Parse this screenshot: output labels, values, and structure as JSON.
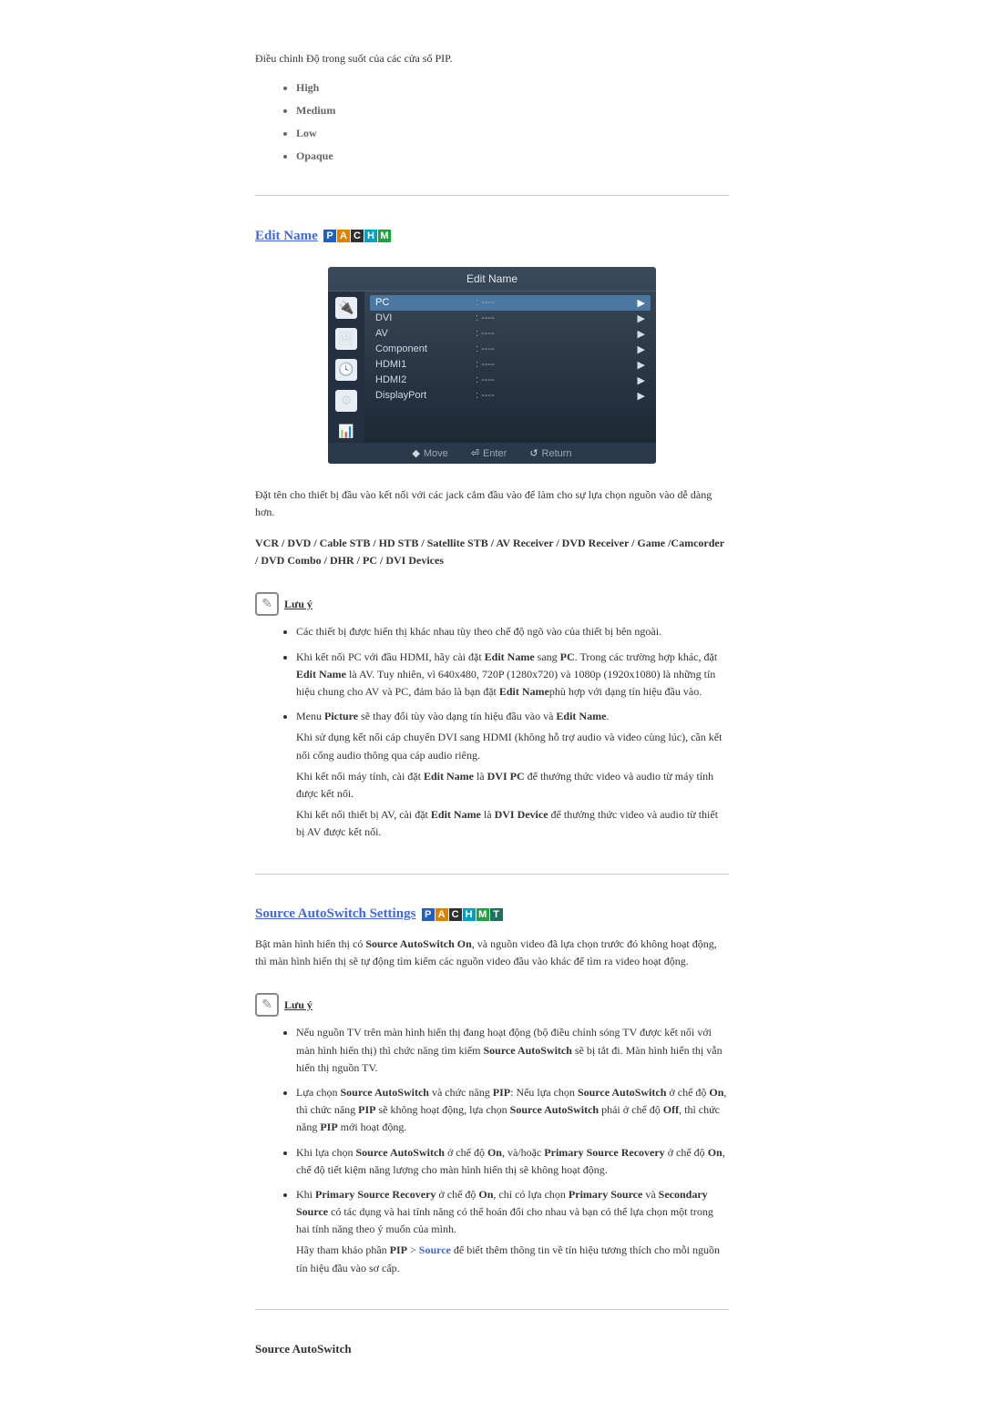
{
  "transparency": {
    "intro": "Điều chỉnh Độ trong suốt của các cửa sổ PIP.",
    "items": [
      "High",
      "Medium",
      "Low",
      "Opaque"
    ]
  },
  "edit_name": {
    "heading": "Edit Name",
    "badges": [
      "P",
      "A",
      "C",
      "H",
      "M"
    ],
    "panel": {
      "title": "Edit Name",
      "rows": [
        {
          "lbl": "PC",
          "mid": ": ----",
          "sel": true
        },
        {
          "lbl": "DVI",
          "mid": ": ----"
        },
        {
          "lbl": "AV",
          "mid": ": ----"
        },
        {
          "lbl": "Component",
          "mid": ": ----"
        },
        {
          "lbl": "HDMI1",
          "mid": ": ----"
        },
        {
          "lbl": "HDMI2",
          "mid": ": ----"
        },
        {
          "lbl": "DisplayPort",
          "mid": ": ----"
        }
      ],
      "footer": {
        "move": "Move",
        "enter": "Enter",
        "return": "Return"
      }
    },
    "desc": "Đặt tên cho thiết bị đầu vào kết nối với các jack cắm đầu vào để làm cho sự lựa chọn nguồn vào dễ dàng hơn.",
    "options": "VCR / DVD / Cable STB / HD STB / Satellite STB / AV Receiver / DVD Receiver / Game /Camcorder / DVD Combo / DHR / PC / DVI Devices",
    "note_label": "Lưu ý",
    "notes": {
      "n1": "Các thiết bị được hiển thị khác nhau tùy theo chế độ ngõ vào của thiết bị bên ngoài.",
      "n2": {
        "pre": "Khi kết nối PC với đầu HDMI, hãy cài đặt ",
        "b1": "Edit Name",
        "mid1": " sang ",
        "b2": "PC",
        "mid2": ". Trong các trường hợp khác, đặt ",
        "b3": "Edit Name",
        "mid3": " là AV. Tuy nhiên, vì 640x480, 720P (1280x720) và 1080p (1920x1080) là những tín hiệu chung cho AV và PC, đảm bảo là bạn đặt ",
        "b4": "Edit Name",
        "post": "phù hợp với dạng tín hiệu đầu vào."
      },
      "n3": {
        "pre": "Menu ",
        "b1": "Picture",
        "mid": " sẽ thay đổi tùy vào dạng tín hiệu đầu vào và ",
        "b2": "Edit Name",
        "post": "."
      },
      "n3_sub1": "Khi sử dụng kết nối cáp chuyển DVI sang HDMI (không hỗ trợ audio và video cùng lúc), cần kết nối cổng audio thông qua cáp audio riêng.",
      "n3_sub2_pre": "Khi kết nối máy tính, cài đặt ",
      "n3_sub2_b1": "Edit Name",
      "n3_sub2_mid": " là ",
      "n3_sub2_b2": "DVI PC",
      "n3_sub2_post": " để thưởng thức video và audio từ máy tính được kết nối.",
      "n3_sub3_pre": "Khi kết nối thiết bị AV, cài đặt ",
      "n3_sub3_b1": "Edit Name",
      "n3_sub3_mid": " là ",
      "n3_sub3_b2": "DVI Device",
      "n3_sub3_post": " để thưởng thức video và audio từ thiết bị AV được kết nối."
    }
  },
  "autoswitch": {
    "heading": "Source AutoSwitch Settings",
    "badges": [
      "P",
      "A",
      "C",
      "H",
      "M",
      "T"
    ],
    "desc": {
      "pre": "Bật màn hình hiển thị có ",
      "b1": "Source AutoSwitch On",
      "post": ", và nguồn video đã lựa chọn trước đó không hoạt động, thì màn hình hiển thị sẽ tự động tìm kiếm các nguồn video đầu vào khác để tìm ra video hoạt động."
    },
    "note_label": "Lưu ý",
    "notes": {
      "n1": {
        "pre": "Nếu nguồn TV trên màn hình hiển thị đang hoạt động (bộ điều chỉnh sóng TV được kết nối với màn hình hiển thị) thì chức năng tìm kiếm ",
        "b1": "Source AutoSwitch",
        "post": " sẽ bị tắt đi. Màn hình hiển thị vẫn hiển thị nguồn TV."
      },
      "n2": {
        "pre": "Lựa chọn ",
        "b1": "Source AutoSwitch",
        "mid1": " và chức năng ",
        "b2": "PIP",
        "mid2": ": Nếu lựa chọn ",
        "b3": "Source AutoSwitch",
        "mid3": " ở chế độ ",
        "b4": "On",
        "mid4": ", thì chức năng ",
        "b5": "PIP",
        "mid5": " sẽ không hoạt động, lựa chọn ",
        "b6": "Source AutoSwitch",
        "mid6": " phải ở chế độ ",
        "b7": "Off",
        "mid7": ", thì chức năng ",
        "b8": "PIP",
        "post": " mới hoạt động."
      },
      "n3": {
        "pre": "Khi lựa chọn ",
        "b1": "Source AutoSwitch",
        "mid1": " ở chế độ ",
        "b2": "On",
        "mid2": ", và/hoặc ",
        "b3": "Primary Source Recovery",
        "mid3": " ở chế độ ",
        "b4": "On",
        "post": ", chế độ tiết kiệm năng lượng cho màn hình hiển thị sẽ không hoạt động."
      },
      "n4": {
        "pre": "Khi ",
        "b1": "Primary Source Recovery",
        "mid1": " ở chế độ ",
        "b2": "On",
        "mid2": ", chỉ có lựa chọn ",
        "b3": "Primary Source",
        "mid3": " và ",
        "b4": "Secondary Source",
        "post": " có tác dụng và hai tính năng có thể hoán đổi cho nhau và bạn có thể lựa chọn một trong hai tính năng theo ý muốn của mình."
      },
      "n4_sub": {
        "pre": "Hãy tham khảo phần ",
        "b1": "PIP",
        "mid": " > ",
        "link": "Source",
        "post": " để biết thêm thông tin về tín hiệu tương thích cho mỗi nguồn tín hiệu đầu vào sơ cấp."
      }
    },
    "subsection": "Source AutoSwitch"
  }
}
